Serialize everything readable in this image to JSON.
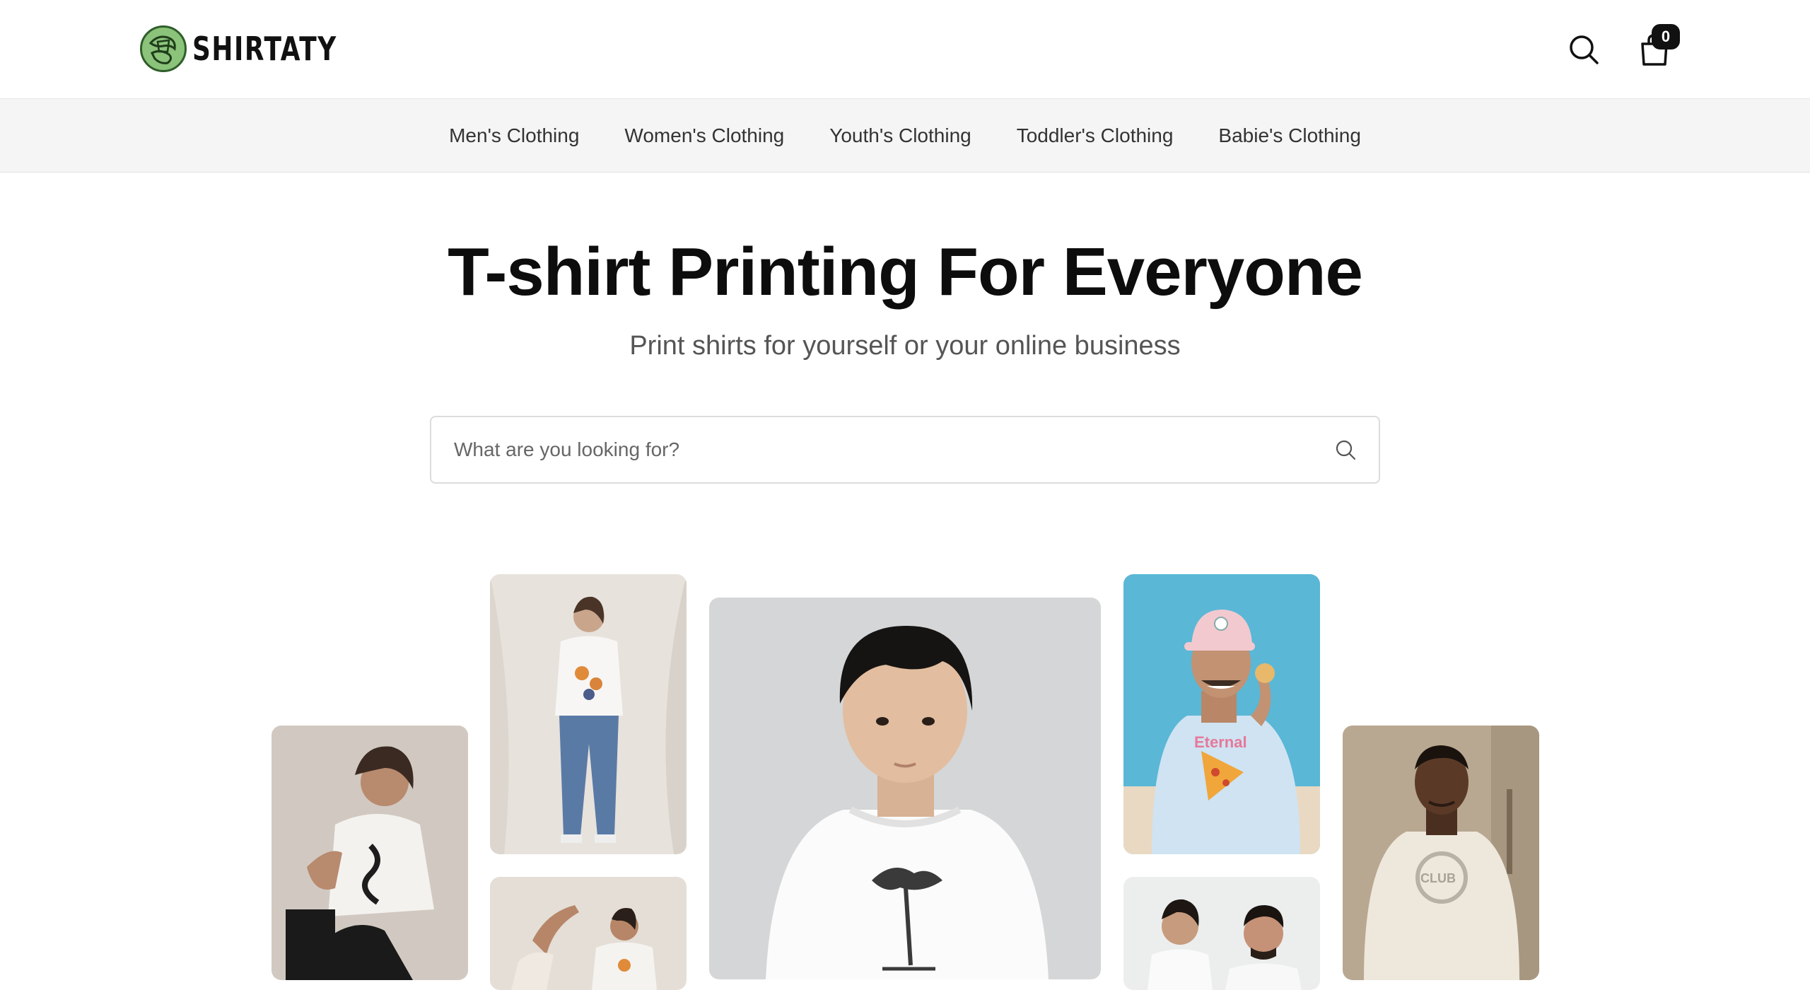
{
  "brand": {
    "name": "SHIRTATY",
    "logo_icon": "globe-shirt-logo"
  },
  "header": {
    "search_icon": "search-icon",
    "cart_icon": "shopping-bag-icon",
    "cart_count": "0"
  },
  "nav": {
    "items": [
      {
        "label": "Men's Clothing"
      },
      {
        "label": "Women's Clothing"
      },
      {
        "label": "Youth's Clothing"
      },
      {
        "label": "Toddler's Clothing"
      },
      {
        "label": "Babie's Clothing"
      }
    ]
  },
  "hero": {
    "title": "T-shirt Printing For Everyone",
    "subtitle": "Print shirts for yourself or your online business"
  },
  "search": {
    "placeholder": "What are you looking for?",
    "value": ""
  },
  "gallery": {
    "images": [
      {
        "name": "woman-seated-snake-tee"
      },
      {
        "name": "woman-standing-floral-tee"
      },
      {
        "name": "woman-dancing-tee"
      },
      {
        "name": "young-man-tree-tee"
      },
      {
        "name": "man-pizza-tee"
      },
      {
        "name": "couple-tees"
      },
      {
        "name": "man-vacation-club-sweatshirt"
      }
    ]
  },
  "colors": {
    "accent": "#111111",
    "logo_green": "#8bc37a",
    "nav_bg": "#f5f5f5"
  }
}
